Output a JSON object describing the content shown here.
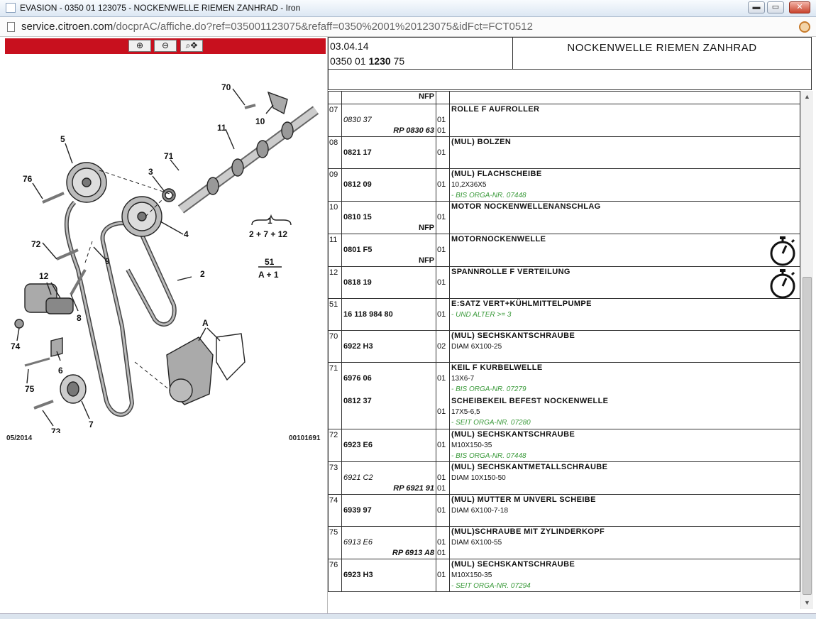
{
  "window": {
    "title": "EVASION - 0350 01 123075 - NOCKENWELLE RIEMEN ZANHRAD - Iron",
    "url_host": "service.citroen.com",
    "url_path": "/docprAC/affiche.do?ref=035001123075&refaff=0350%2001%20123075&idFct=FCT0512",
    "minimize": "▬",
    "maximize": "▭",
    "close": "✕"
  },
  "toolbar": {
    "zoom_in": "⊕",
    "zoom_out": "⊖",
    "zoom_pan": "⌕✥"
  },
  "diagram": {
    "labels": [
      "70",
      "10",
      "11",
      "5",
      "71",
      "3",
      "76",
      "4",
      "1",
      "2 + 7 + 12",
      "72",
      "9",
      "51",
      "A + 1",
      "12",
      "2",
      "8",
      "74",
      "A",
      "6",
      "75",
      "7",
      "73"
    ],
    "date": "05/2014",
    "code": "00101691"
  },
  "header": {
    "date": "03.04.14",
    "ref_pre": "0350 01 ",
    "ref_bold": "1230",
    "ref_post": " 75",
    "title": "NOCKENWELLE RIEMEN ZANHRAD"
  },
  "table": {
    "head_nfp": "NFP",
    "rows": [
      {
        "no": "07",
        "ref": "0830 37",
        "ref_italic": true,
        "qty": "01",
        "rp": "RP 0830 63",
        "rp_qty": "01",
        "name": "ROLLE F AUFROLLER",
        "sub": "",
        "note": "",
        "nfp": "",
        "clock": false
      },
      {
        "no": "08",
        "ref": "0821 17",
        "qty": "01",
        "name": "(MUL) BOLZEN",
        "sub": "",
        "note": "",
        "nfp": "",
        "clock": false
      },
      {
        "no": "09",
        "ref": "0812 09",
        "qty": "01",
        "name": "(MUL) FLACHSCHEIBE",
        "sub": "10,2X36X5",
        "note": "- BIS ORGA-NR. 07448",
        "nfp": "",
        "clock": false
      },
      {
        "no": "10",
        "ref": "0810 15",
        "qty": "01",
        "name": "MOTOR NOCKENWELLENANSCHLAG",
        "sub": "",
        "note": "",
        "nfp": "NFP",
        "clock": false
      },
      {
        "no": "11",
        "ref": "0801 F5",
        "qty": "01",
        "name": "MOTORNOCKENWELLE",
        "sub": "",
        "note": "",
        "nfp": "NFP",
        "clock": true
      },
      {
        "no": "12",
        "ref": "0818 19",
        "qty": "01",
        "name": "SPANNROLLE F VERTEILUNG",
        "sub": "",
        "note": "",
        "nfp": "",
        "clock": true
      },
      {
        "no": "51",
        "ref": "16 118 984 80",
        "qty": "01",
        "name": "E:SATZ VERT+KÜHLMITTELPUMPE",
        "sub": "",
        "note": "- UND ALTER >= 3",
        "nfp": "",
        "clock": false
      },
      {
        "no": "70",
        "ref": "6922 H3",
        "qty": "02",
        "name": "(MUL) SECHSKANTSCHRAUBE",
        "sub": "DIAM 6X100-25",
        "note": "",
        "nfp": "",
        "clock": false
      },
      {
        "no": "71",
        "ref": "6976 06",
        "qty": "01",
        "name": "KEIL F KURBELWELLE",
        "sub": "13X6-7",
        "note": "- BIS ORGA-NR. 07279",
        "nfp": "",
        "clock": false,
        "ref2": "0812 37",
        "qty2": "01",
        "name2": "SCHEIBEKEIL BEFEST NOCKENWELLE",
        "sub2": "17X5-6,5",
        "note2": "- SEIT ORGA-NR. 07280"
      },
      {
        "no": "72",
        "ref": "6923 E6",
        "qty": "01",
        "name": "(MUL) SECHSKANTSCHRAUBE",
        "sub": "M10X150-35",
        "note": "- BIS ORGA-NR. 07448",
        "nfp": "",
        "clock": false
      },
      {
        "no": "73",
        "ref": "6921 C2",
        "ref_italic": true,
        "qty": "01",
        "rp": "RP 6921 91",
        "rp_qty": "01",
        "name": "(MUL) SECHSKANTMETALLSCHRAUBE",
        "sub": "DIAM 10X150-50",
        "note": "",
        "nfp": "",
        "clock": false
      },
      {
        "no": "74",
        "ref": "6939 97",
        "qty": "01",
        "name": "(MUL) MUTTER M UNVERL SCHEIBE",
        "sub": "DIAM 6X100-7-18",
        "note": "",
        "nfp": "",
        "clock": false
      },
      {
        "no": "75",
        "ref": "6913 E6",
        "ref_italic": true,
        "qty": "01",
        "rp": "RP 6913 A8",
        "rp_qty": "01",
        "name": "(MUL)SCHRAUBE MIT ZYLINDERKOPF",
        "sub": "DIAM 6X100-55",
        "note": "",
        "nfp": "",
        "clock": false
      },
      {
        "no": "76",
        "ref": "6923 H3",
        "qty": "01",
        "name": "(MUL) SECHSKANTSCHRAUBE",
        "sub": "M10X150-35",
        "note": "- SEIT ORGA-NR. 07294",
        "nfp": "",
        "clock": false
      }
    ]
  }
}
